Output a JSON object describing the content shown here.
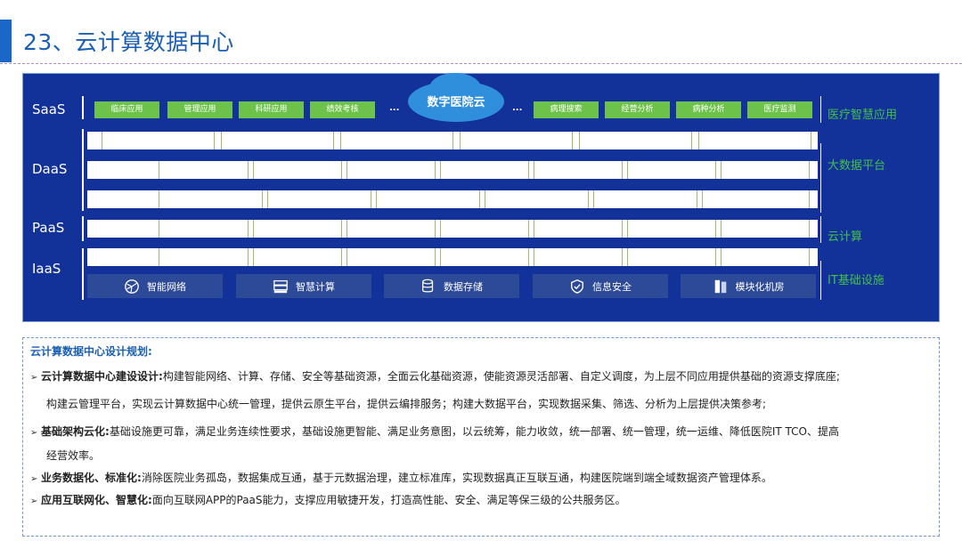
{
  "title": "23、云计算数据中心",
  "diagram": {
    "layers": [
      "SaaS",
      "DaaS",
      "PaaS",
      "IaaS"
    ],
    "cloud_label": "数字医院云",
    "apps_left": [
      "临床应用",
      "管理应用",
      "科研应用",
      "绩效考核"
    ],
    "apps_right": [
      "病理搜索",
      "经营分析",
      "病种分析",
      "医疗监测"
    ],
    "ellipsis": "...",
    "right_labels": [
      "医疗智慧应用",
      "大数据平台",
      "云计算",
      "IT基础设施"
    ],
    "infra": [
      {
        "label": "智能网络",
        "icon": "network-globe-icon"
      },
      {
        "label": "智慧计算",
        "icon": "server-icon"
      },
      {
        "label": "数据存储",
        "icon": "database-icon"
      },
      {
        "label": "信息安全",
        "icon": "shield-check-icon"
      },
      {
        "label": "模块化机房",
        "icon": "server-rack-icon"
      }
    ],
    "colors": {
      "background": "#12329a",
      "chip": "#6cc24a",
      "cloud": "#2f8fdd",
      "label_green": "#44c048"
    }
  },
  "notes": {
    "heading": "云计算数据中心设计规划:",
    "items": [
      {
        "bold": "云计算数据中心建设设计:",
        "text": "构建智能网络、计算、存储、安全等基础资源，全面云化基础资源，使能资源灵活部署、自定义调度，为上层不同应用提供基础的资源支撑底座;",
        "cont": "构建云管理平台，实现云计算数据中心统一管理，提供云原生平台，提供云编排服务；构建大数据平台，实现数据采集、筛选、分析为上层提供决策参考;"
      },
      {
        "bold": "基础架构云化:",
        "text": "基础设施更可靠，满足业务连续性要求，基础设施更智能、满足业务意图，以云统筹，能力收敛，统一部署、统一管理，统一运维、降低医院IT TCO、提高",
        "cont": "经营效率。"
      },
      {
        "bold": "业务数据化、标准化:",
        "text": "消除医院业务孤岛，数据集成互通，基于元数据治理，建立标准库，实现数据真正互联互通，构建医院端到端全域数据资产管理体系。"
      },
      {
        "bold": "应用互联网化、智慧化:",
        "text": "面向互联网APP的PaaS能力，支撑应用敏捷开发，打造高性能、安全、满足等保三级的公共服务区。"
      }
    ]
  }
}
